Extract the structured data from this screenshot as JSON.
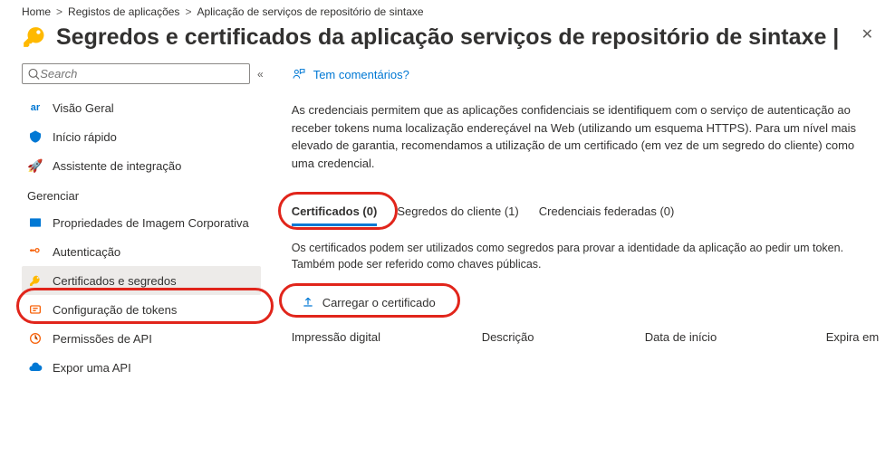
{
  "breadcrumb": {
    "home": "Home",
    "sep": ">",
    "app_reg": "Registos de aplicações",
    "app_name": "Aplicação de serviços de repositório de sintaxe"
  },
  "header": {
    "title": "Segredos e certificados da aplicação serviços de repositório de sintaxe |"
  },
  "search": {
    "placeholder": "Search"
  },
  "sidebar": {
    "items": [
      {
        "label": "Visão Geral"
      },
      {
        "label": "Início rápido"
      },
      {
        "label": "Assistente de integração"
      }
    ],
    "manage_label": "Gerenciar",
    "manage_items": [
      {
        "label": "Propriedades de Imagem Corporativa"
      },
      {
        "label": "Autenticação"
      },
      {
        "label": "Certificados e segredos"
      },
      {
        "label": "Configuração de tokens"
      },
      {
        "label": "Permissões de API"
      },
      {
        "label": "Expor uma API"
      }
    ]
  },
  "main": {
    "feedback": "Tem comentários?",
    "description": "As credenciais permitem que as aplicações confidenciais se identifiquem com o serviço de autenticação ao receber tokens numa localização endereçável na Web (utilizando um esquema HTTPS). Para um nível mais elevado de garantia, recomendamos a utilização de um certificado (em vez de um segredo do cliente) como uma credencial.",
    "tabs": {
      "certificates": "Certificados (0)",
      "client_secrets": "Segredos do cliente (1)",
      "federated": "Credenciais federadas (0)"
    },
    "cert_desc": "Os certificados podem ser utilizados como segredos para provar a identidade da aplicação ao pedir um token. Também pode ser referido como chaves públicas.",
    "upload_label": "Carregar o certificado",
    "columns": {
      "thumbprint": "Impressão digital",
      "description": "Descrição",
      "start_date": "Data de início",
      "expires": "Expira em"
    }
  }
}
